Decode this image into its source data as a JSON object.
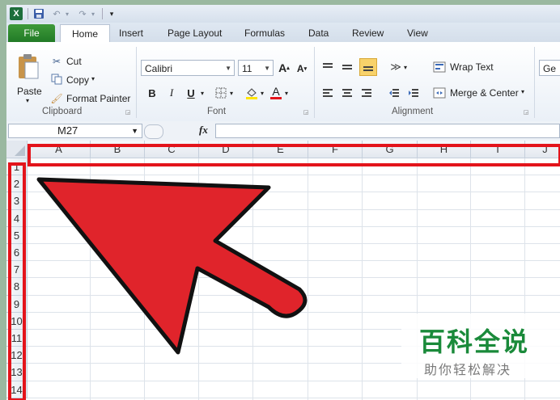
{
  "quick_access": {
    "app_icon": "X"
  },
  "tabs": [
    "File",
    "Home",
    "Insert",
    "Page Layout",
    "Formulas",
    "Data",
    "Review",
    "View"
  ],
  "clipboard": {
    "paste": "Paste",
    "cut": "Cut",
    "copy": "Copy",
    "format_painter": "Format Painter",
    "group": "Clipboard"
  },
  "font": {
    "name": "Calibri",
    "size": "11",
    "bold": "B",
    "italic": "I",
    "underline": "U",
    "font_color_letter": "A",
    "group": "Font"
  },
  "alignment": {
    "wrap_text": "Wrap Text",
    "merge_center": "Merge & Center",
    "group": "Alignment"
  },
  "number": {
    "format_partial": "Ge"
  },
  "formula_bar": {
    "name_box": "M27",
    "fx": "fx"
  },
  "columns": [
    "A",
    "B",
    "C",
    "D",
    "E",
    "F",
    "G",
    "H",
    "I",
    "J"
  ],
  "rows": [
    "1",
    "2",
    "3",
    "4",
    "5",
    "6",
    "7",
    "8",
    "9",
    "10",
    "11",
    "12",
    "13",
    "14"
  ],
  "watermark": {
    "title": "百科全说",
    "subtitle": "助你轻松解决"
  },
  "colors": {
    "highlight": "#e3141b",
    "arrow": "#e0242b",
    "file_tab": "#2e8b31",
    "brand": "#1a8a3a"
  }
}
